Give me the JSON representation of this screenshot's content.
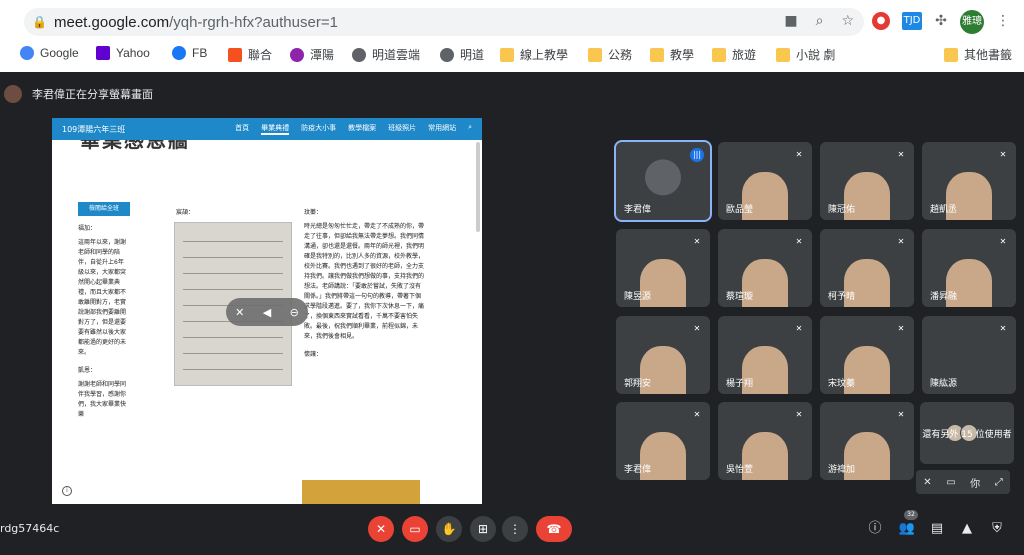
{
  "browser": {
    "url_main": "meet.google.com",
    "url_path": "/yqh-rgrh-hfx?authuser=1",
    "profile_label": "雅璁",
    "ext_label": "TJD",
    "bookmarks": [
      "Google",
      "Yahoo",
      "FB",
      "聯合",
      "潭陽",
      "明道雲端",
      "明道",
      "線上教學",
      "公務",
      "教學",
      "旅遊",
      "小說 劇",
      "其他書籤"
    ]
  },
  "share_banner": "李君偉正在分享螢幕畫面",
  "presentation": {
    "site_title": "109潭陽六年三班",
    "nav": [
      "首頁",
      "畢業典禮",
      "防疫大小事",
      "教學檔案",
      "班級照片",
      "常用網站"
    ],
    "page_heading": "畢業感恩牆",
    "button": "檢閱給全班",
    "col1_head": "福加：",
    "col1_text": "這兩年以來，謝謝老師和同學的陪伴，自從升上6年級以來，大家都突然開心起畢業典禮，而且大家都不敢離開對方，老實說謝部我們要離開對方了，但是還要要有雖然以後大家都能過的更好的未來。",
    "col1_head2": "凱恩：",
    "col1_text2": "謝謝老師和同學同伴我學習，感謝你們，我大家畢業快樂",
    "col2_head": "宸頡：",
    "col3_head": "玟蓁：",
    "col3_text": "時光總是匆匆忙忙走，帶走了不成熟的你，帶走了往事，但卻給我無法帶走夢想。我們同情溝通，卻也還是還餐。兩年的師光裡，我們明確是我特別的，比別人多的資源，校外教學，校外比賽。我們也遇到了很好的老師，全力支持我們。讓我們做我們想做的事，支持我們的想法。老師講說：「要敢於嘗試，失敗了沒有關係。」我們將帶這一句句的教導，帶著下個求學階段邁進。要了，我你下次休息一下，痛了，換個東西來實試看看，千萬不要害怕失敗。最後，祝我們順利畢業，前程似錦，未來，我們後會相見。",
    "col3_head2": "懷讓："
  },
  "participants": [
    {
      "name": "李君偉",
      "speaking": true
    },
    {
      "name": "歐品瑩",
      "speaking": false
    },
    {
      "name": "陳冠佑",
      "speaking": false
    },
    {
      "name": "趙凱丞",
      "speaking": false
    },
    {
      "name": "陳昱源",
      "speaking": false
    },
    {
      "name": "蔡瑄璇",
      "speaking": false
    },
    {
      "name": "柯予晴",
      "speaking": false
    },
    {
      "name": "潘昇融",
      "speaking": false
    },
    {
      "name": "郭翔安",
      "speaking": false
    },
    {
      "name": "楊子翔",
      "speaking": false
    },
    {
      "name": "宋玟蓁",
      "speaking": false
    },
    {
      "name": "陳紘源",
      "speaking": false
    },
    {
      "name": "李君偉",
      "speaking": false
    },
    {
      "name": "吳怡萱",
      "speaking": false
    },
    {
      "name": "游禕加",
      "speaking": false
    }
  ],
  "more_users": "還有另外 15 位使用者",
  "mini_ctrl_label": "你",
  "meeting_code": "rdg57464c",
  "participant_count": "32"
}
